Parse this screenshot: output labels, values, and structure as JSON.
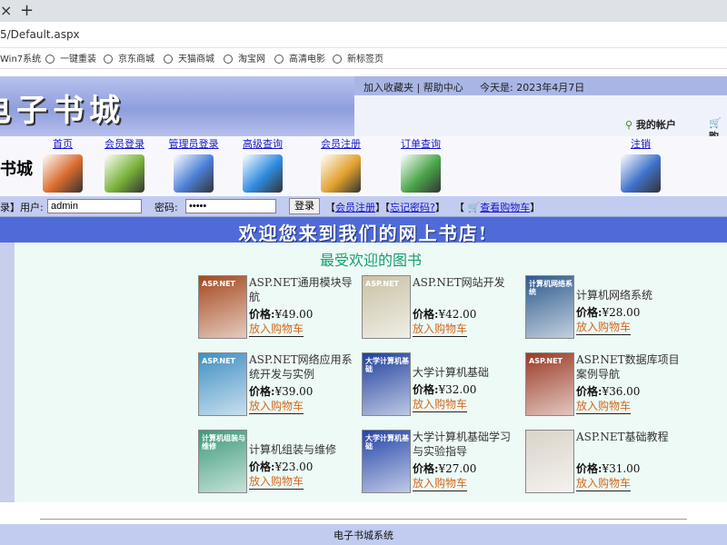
{
  "browser": {
    "new_tab": "+",
    "url": "5/Default.aspx",
    "bookmarks": [
      "Win7系统",
      "一键重装",
      "京东商城",
      "天猫商城",
      "淘宝网",
      "高清电影",
      "新标签页"
    ]
  },
  "header": {
    "site_title": "电子书城",
    "top_links": "加入收藏夹 | 帮助中心",
    "date_text": "今天是: 2023年4月7日",
    "my_account": "我的帐户",
    "cart_link": "购",
    "logo_small": "书城"
  },
  "nav": {
    "items": [
      {
        "label": "首页",
        "icon": "home-icon",
        "color": "#d96b2e"
      },
      {
        "label": "会员登录",
        "icon": "books-stack-icon",
        "color": "#7ab33a"
      },
      {
        "label": "管理员登录",
        "icon": "window-panel-icon",
        "color": "#4a7fd6"
      },
      {
        "label": "高级查询",
        "icon": "globe-search-icon",
        "color": "#2f8be0"
      },
      {
        "label": "会员注册",
        "icon": "people-icon",
        "color": "#e1a22f"
      },
      {
        "label": "订单查询",
        "icon": "book-stack-icon",
        "color": "#4aa54a"
      },
      {
        "label": "注销",
        "icon": "logout-icon",
        "color": "#3f71c9"
      }
    ]
  },
  "login": {
    "prefix": "录】用户:",
    "username": "admin",
    "password_label": "密码:",
    "password": "•••••",
    "submit": "登录",
    "register": "会员注册",
    "forgot": "忘记密码?",
    "cart": "查看购物车"
  },
  "welcome": "欢迎您来到我们的网上书店!",
  "section_title": "最受欢迎的图书",
  "price_label": "价格:",
  "add_to_cart": "放入购物车",
  "books": [
    {
      "title": "ASP.NET通用模块导航",
      "price": "¥49.00",
      "cover": "#a5481d",
      "cover_text": "ASP.NET"
    },
    {
      "title": "ASP.NET网站开发",
      "price": "¥42.00",
      "cover": "#c9c2a6",
      "cover_text": "ASP.NET"
    },
    {
      "title": "计算机网络系统",
      "price": "¥28.00",
      "cover": "#2d5a8c",
      "cover_text": "计算机网络系统"
    },
    {
      "title": "ASP.NET网络应用系统开发与实例",
      "price": "¥39.00",
      "cover": "#3f8fc4",
      "cover_text": "ASP.NET"
    },
    {
      "title": "大学计算机基础",
      "price": "¥32.00",
      "cover": "#1f3f9e",
      "cover_text": "大学计算机基础"
    },
    {
      "title": "ASP.NET数据库项目案例导航",
      "price": "¥36.00",
      "cover": "#9a3a25",
      "cover_text": "ASP.NET"
    },
    {
      "title": "计算机组装与维修",
      "price": "¥23.00",
      "cover": "#3c9a7a",
      "cover_text": "计算机组装与维修"
    },
    {
      "title": "大学计算机基础学习与实验指导",
      "price": "¥27.00",
      "cover": "#2344a8",
      "cover_text": "大学计算机基础"
    },
    {
      "title": "ASP.NET基础教程",
      "price": "¥31.00",
      "cover": "#d9d3c8",
      "cover_text": ""
    }
  ],
  "footer": "电子书城系统"
}
